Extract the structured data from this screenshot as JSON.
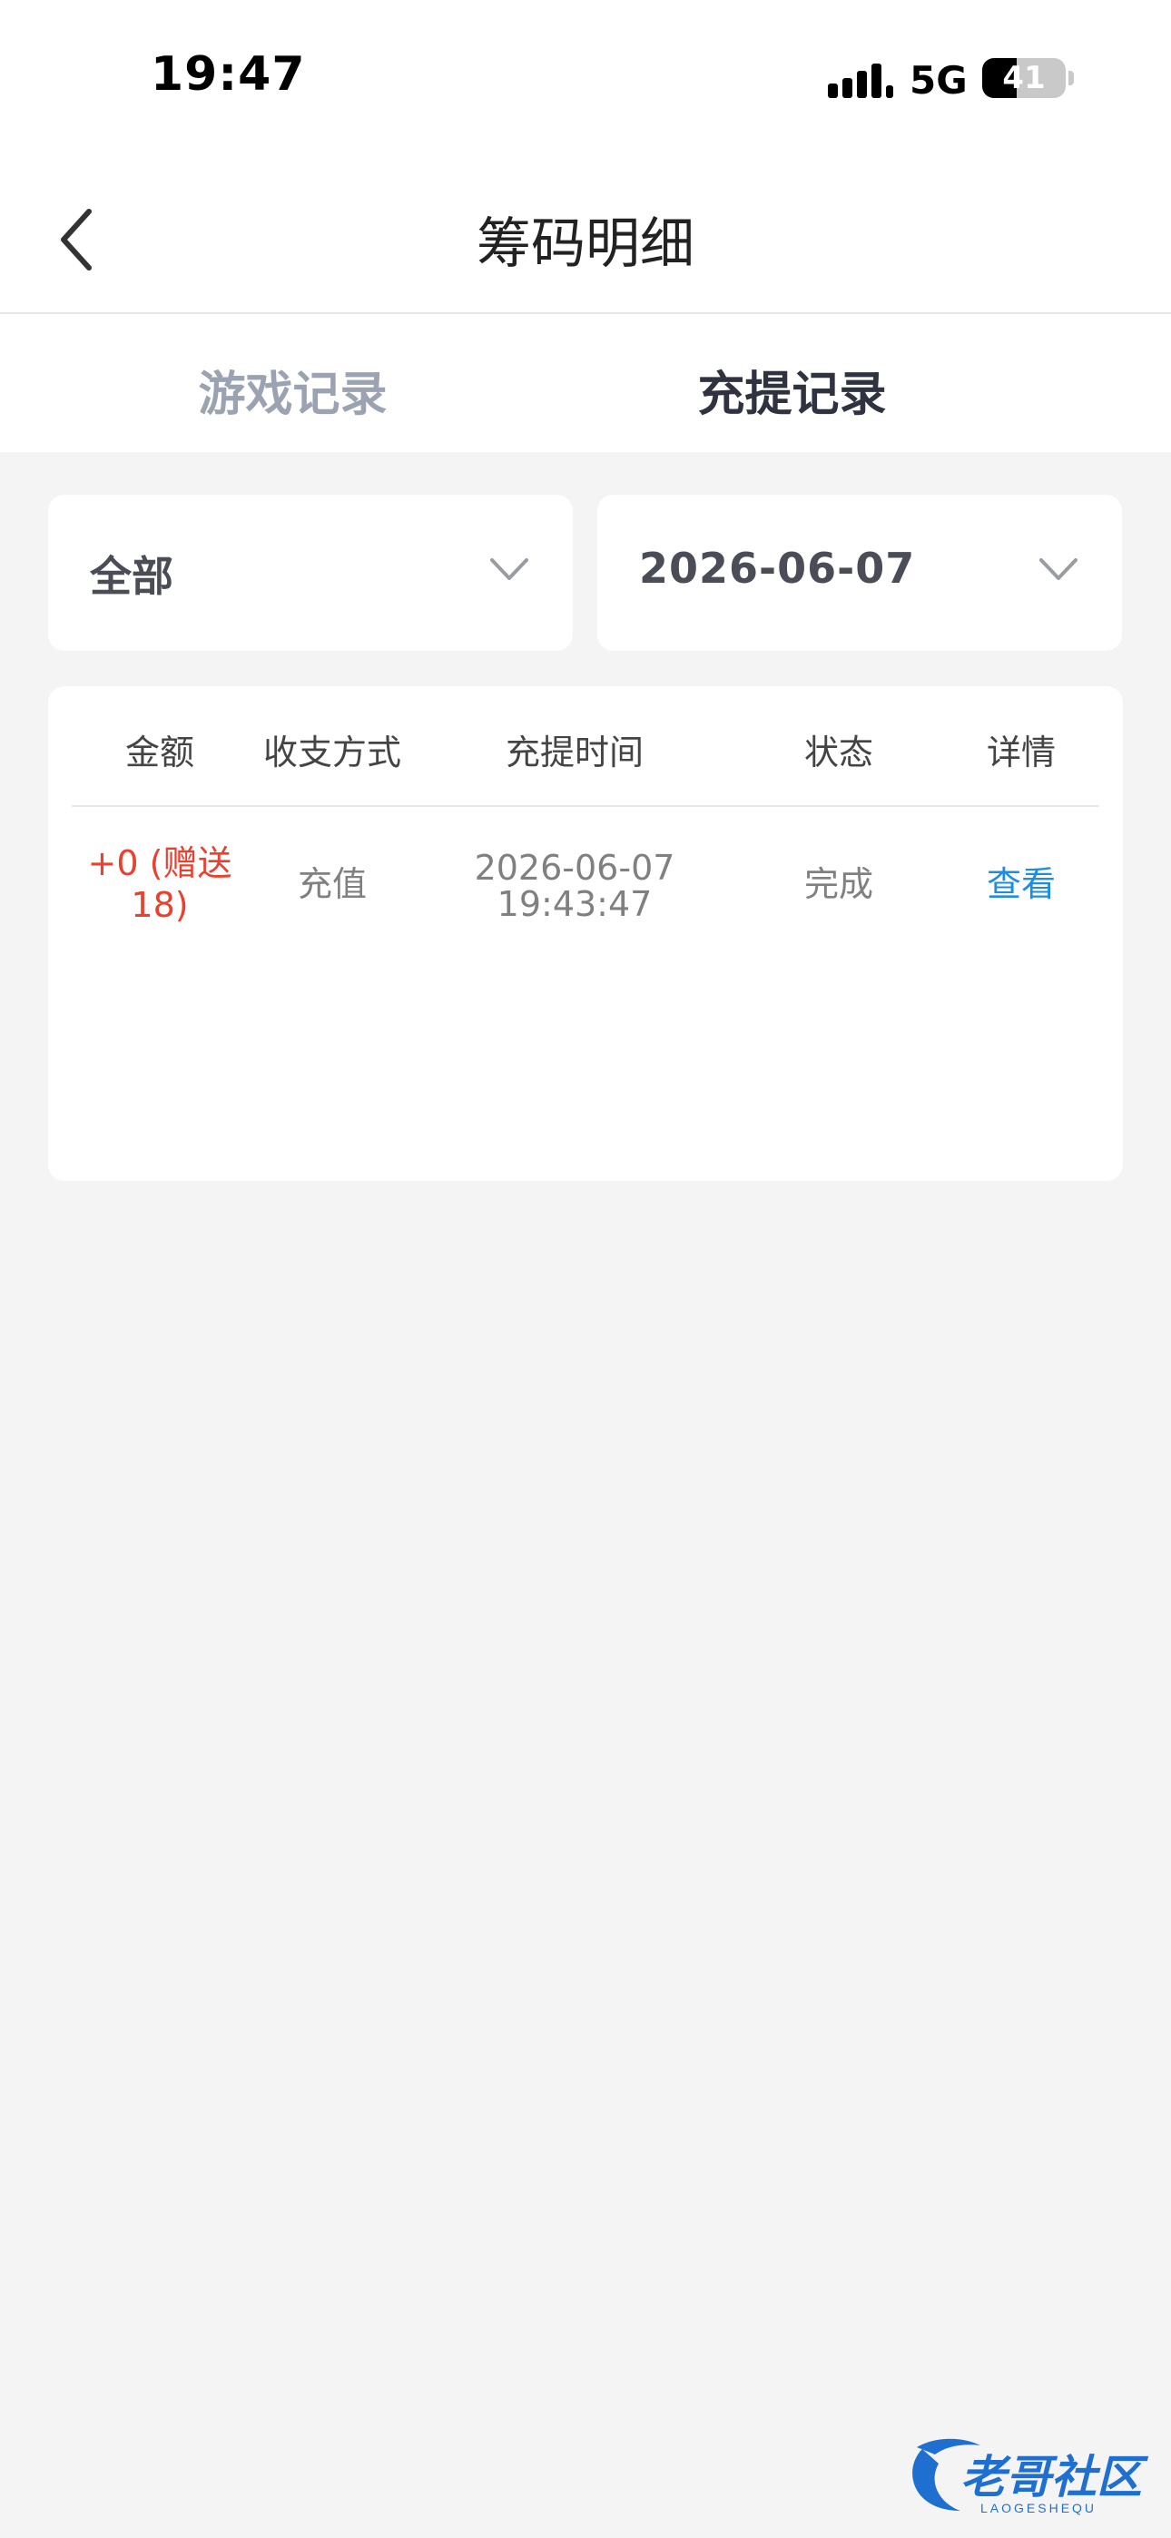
{
  "status_bar": {
    "time": "19:47",
    "network": "5G",
    "battery_level": "41",
    "battery_fraction": 0.41
  },
  "nav": {
    "title": "筹码明细"
  },
  "tabs": [
    {
      "label": "游戏记录",
      "active": false
    },
    {
      "label": "充提记录",
      "active": true
    }
  ],
  "filters": {
    "type": "全部",
    "date": "2026-06-07"
  },
  "table": {
    "headers": [
      "金额",
      "收支方式",
      "充提时间",
      "状态",
      "详情"
    ],
    "rows": [
      {
        "amount_line1": "+0 (赠送",
        "amount_line2": "18)",
        "method": "充值",
        "date": "2026-06-07",
        "time": "19:43:47",
        "status": "完成",
        "detail": "查看"
      }
    ]
  },
  "watermark": {
    "text": "老哥社区",
    "subtext": "LAOGESHEQU"
  },
  "colors": {
    "accent_link": "#1e8de0",
    "amount_red": "#e8412f",
    "tab_inactive": "#9ba3b2",
    "tab_active": "#2f3340"
  }
}
